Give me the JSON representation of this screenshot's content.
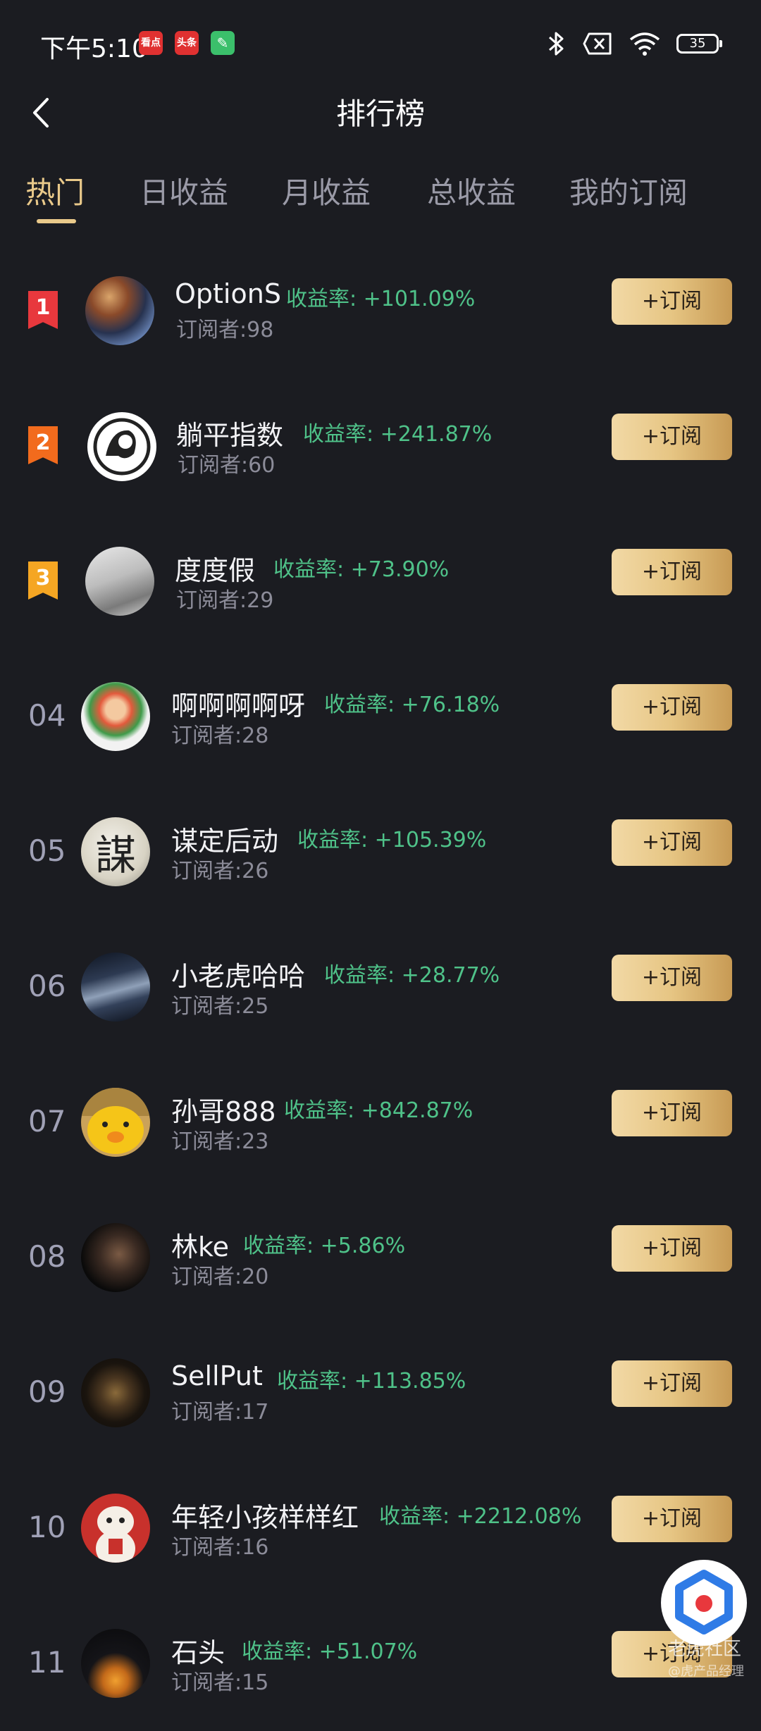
{
  "status_bar": {
    "time": "下午5:10",
    "notif_1": "看点",
    "notif_2": "头条",
    "battery": "35"
  },
  "header": {
    "title": "排行榜"
  },
  "tabs": [
    {
      "label": "热门"
    },
    {
      "label": "日收益"
    },
    {
      "label": "月收益"
    },
    {
      "label": "总收益"
    },
    {
      "label": "我的订阅"
    }
  ],
  "list": [
    {
      "rank": "1",
      "name": "OptionS",
      "rate": "收益率: +101.09%",
      "subs": "订阅者:98",
      "button": "+订阅"
    },
    {
      "rank": "2",
      "name": "躺平指数",
      "rate": "收益率: +241.87%",
      "subs": "订阅者:60",
      "button": "+订阅"
    },
    {
      "rank": "3",
      "name": "度度假",
      "rate": "收益率: +73.90%",
      "subs": "订阅者:29",
      "button": "+订阅"
    },
    {
      "rank": "04",
      "name": "啊啊啊啊呀",
      "rate": "收益率: +76.18%",
      "subs": "订阅者:28",
      "button": "+订阅"
    },
    {
      "rank": "05",
      "name": "谋定后动",
      "rate": "收益率: +105.39%",
      "subs": "订阅者:26",
      "button": "+订阅"
    },
    {
      "rank": "06",
      "name": "小老虎哈哈",
      "rate": "收益率: +28.77%",
      "subs": "订阅者:25",
      "button": "+订阅"
    },
    {
      "rank": "07",
      "name": "孙哥888",
      "rate": "收益率: +842.87%",
      "subs": "订阅者:23",
      "button": "+订阅"
    },
    {
      "rank": "08",
      "name": "林ke",
      "rate": "收益率: +5.86%",
      "subs": "订阅者:20",
      "button": "+订阅"
    },
    {
      "rank": "09",
      "name": "SellPut",
      "rate": "收益率: +113.85%",
      "subs": "订阅者:17",
      "button": "+订阅"
    },
    {
      "rank": "10",
      "name": "年轻小孩样样红",
      "rate": "收益率: +2212.08%",
      "subs": "订阅者:16",
      "button": "+订阅"
    },
    {
      "rank": "11",
      "name": "石头",
      "rate": "收益率: +51.07%",
      "subs": "订阅者:15",
      "button": "+订阅"
    }
  ],
  "avatar_5_char": "謀",
  "watermark": {
    "line1": "老虎社区",
    "line2": "@虎产品经理"
  },
  "colors": {
    "background": "#1b1c21",
    "accent_gold": "#e9c98a",
    "rate_green": "#4fc289",
    "rank1": "#e8383d",
    "rank2": "#f26b1d",
    "rank3": "#f5a623"
  }
}
